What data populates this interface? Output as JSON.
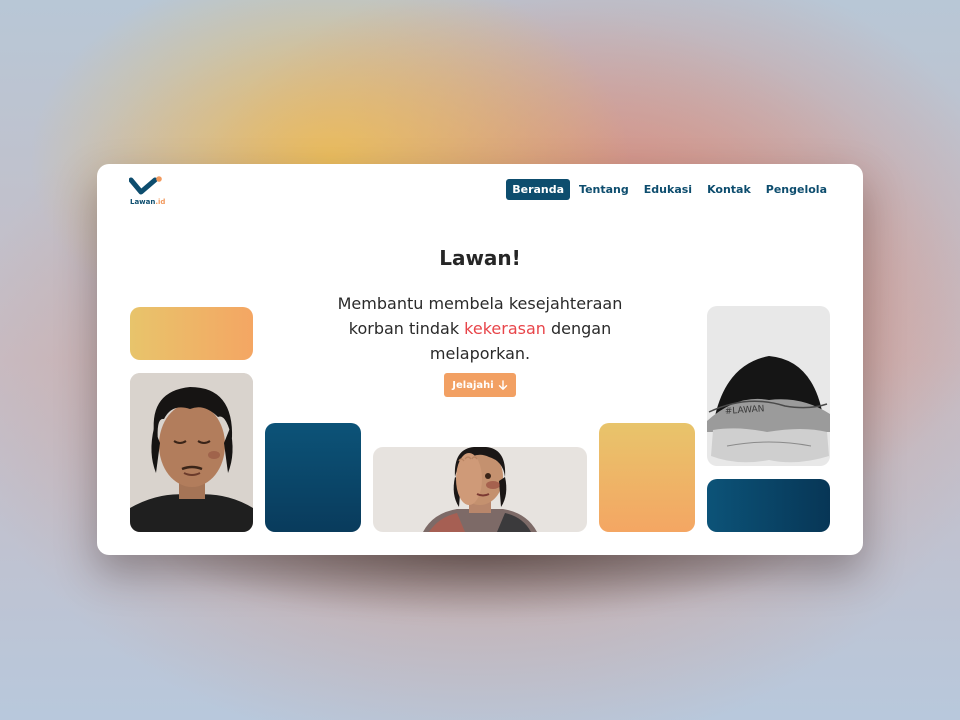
{
  "brand": {
    "name": "Lawan",
    "ext": ".id",
    "colors": {
      "primary": "#0d4d6e",
      "accent": "#f29a5e",
      "highlight": "#e8454a"
    }
  },
  "nav": {
    "items": [
      {
        "label": "Beranda",
        "active": true
      },
      {
        "label": "Tentang",
        "active": false
      },
      {
        "label": "Edukasi",
        "active": false
      },
      {
        "label": "Kontak",
        "active": false
      },
      {
        "label": "Pengelola",
        "active": false
      }
    ]
  },
  "hero": {
    "title": "Lawan!",
    "subtitle_part1": "Membantu membela kesejahteraan korban tindak ",
    "subtitle_highlight": "kekerasan",
    "subtitle_part2": " dengan melaporkan.",
    "cta_label": "Jelajahi",
    "cta_icon": "arrow-down-icon"
  },
  "photos": {
    "arm_text": "#LAWAN"
  }
}
